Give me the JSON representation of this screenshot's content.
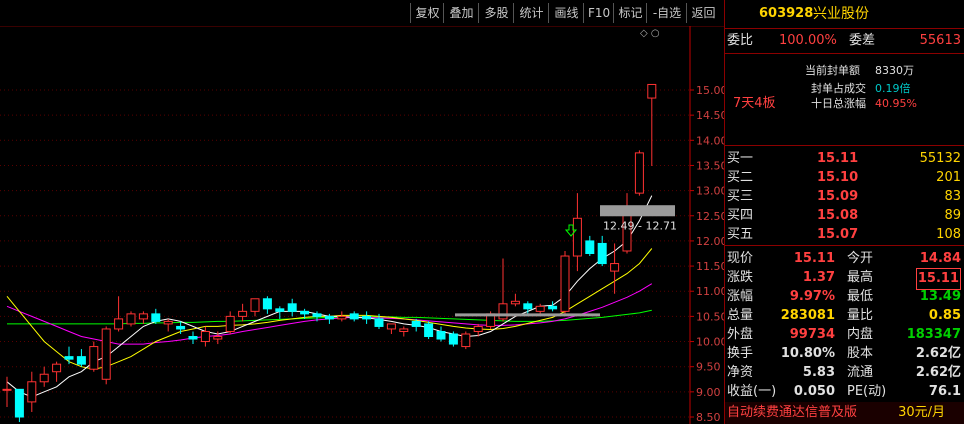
{
  "toolbar": {
    "buttons": [
      "复权",
      "叠加",
      "多股",
      "统计",
      "画线",
      "F10",
      "标记",
      "-自选",
      "返回"
    ]
  },
  "chart": {
    "corner_icons": "◇ ○",
    "price_axis": [
      "15.00",
      "14.50",
      "14.00",
      "13.50",
      "13.00",
      "12.50",
      "12.00",
      "11.50",
      "11.00",
      "10.50",
      "10.00",
      "9.50",
      "9.00",
      "8.50"
    ],
    "range_label": "12.49 - 12.71"
  },
  "quote": {
    "code": "603928",
    "name": "兴业股份",
    "weibi_label": "委比",
    "weibi_value": "100.00%",
    "weicha_label": "委差",
    "weicha_value": "55613",
    "seal_amount_label": "当前封单额",
    "seal_amount_value": "8330万",
    "seal_ratio_label": "封单占成交",
    "seal_ratio_value": "0.19倍",
    "ten_day_label": "十日总涨幅",
    "ten_day_value": "40.95%",
    "streak": "7天4板",
    "bids": [
      {
        "label": "买一",
        "price": "15.11",
        "vol": "55132"
      },
      {
        "label": "买二",
        "price": "15.10",
        "vol": "201"
      },
      {
        "label": "买三",
        "price": "15.09",
        "vol": "83"
      },
      {
        "label": "买四",
        "price": "15.08",
        "vol": "89"
      },
      {
        "label": "买五",
        "price": "15.07",
        "vol": "108"
      }
    ],
    "stats": [
      {
        "l1": "现价",
        "v1": "15.11",
        "l2": "今开",
        "v2": "14.84"
      },
      {
        "l1": "涨跌",
        "v1": "1.37",
        "l2": "最高",
        "v2": "15.11"
      },
      {
        "l1": "涨幅",
        "v1": "9.97%",
        "l2": "最低",
        "v2": "13.49"
      },
      {
        "l1": "总量",
        "v1": "283081",
        "l2": "量比",
        "v2": "0.85"
      },
      {
        "l1": "外盘",
        "v1": "99734",
        "l2": "内盘",
        "v2": "183347"
      },
      {
        "l1": "换手",
        "v1": "10.80%",
        "l2": "股本",
        "v2": "2.62亿"
      },
      {
        "l1": "净资",
        "v1": "5.83",
        "l2": "流通",
        "v2": "2.62亿"
      },
      {
        "l1": "收益(一)",
        "v1": "0.050",
        "l2": "PE(动)",
        "v2": "76.1"
      }
    ],
    "promo": "自动续费通达信普及版",
    "promo_price": "30元/月"
  },
  "colors": {
    "up": "#ff3232",
    "down": "#00ffff",
    "ma5": "#ffffff",
    "ma10": "#ffff00",
    "ma20": "#ff00ff",
    "ma60": "#00ff00",
    "axis": "#c00000"
  },
  "chart_data": {
    "type": "candlestick",
    "candles": [
      {
        "o": 9.05,
        "h": 9.3,
        "l": 8.7,
        "c": 9.05
      },
      {
        "o": 9.05,
        "h": 9.0,
        "l": 8.4,
        "c": 8.5
      },
      {
        "o": 8.8,
        "h": 9.4,
        "l": 8.6,
        "c": 9.2
      },
      {
        "o": 9.2,
        "h": 9.5,
        "l": 9.1,
        "c": 9.35
      },
      {
        "o": 9.4,
        "h": 9.6,
        "l": 9.2,
        "c": 9.55
      },
      {
        "o": 9.7,
        "h": 9.9,
        "l": 9.55,
        "c": 9.65
      },
      {
        "o": 9.7,
        "h": 9.85,
        "l": 9.5,
        "c": 9.55
      },
      {
        "o": 9.45,
        "h": 10.0,
        "l": 9.4,
        "c": 9.9
      },
      {
        "o": 9.25,
        "h": 10.3,
        "l": 9.15,
        "c": 10.25
      },
      {
        "o": 10.25,
        "h": 10.9,
        "l": 10.2,
        "c": 10.45
      },
      {
        "o": 10.35,
        "h": 10.6,
        "l": 10.3,
        "c": 10.55
      },
      {
        "o": 10.45,
        "h": 10.6,
        "l": 10.35,
        "c": 10.55
      },
      {
        "o": 10.55,
        "h": 10.65,
        "l": 10.35,
        "c": 10.4
      },
      {
        "o": 10.35,
        "h": 10.45,
        "l": 10.2,
        "c": 10.4
      },
      {
        "o": 10.3,
        "h": 10.4,
        "l": 10.15,
        "c": 10.25
      },
      {
        "o": 10.1,
        "h": 10.2,
        "l": 9.95,
        "c": 10.05
      },
      {
        "o": 10.0,
        "h": 10.3,
        "l": 9.9,
        "c": 10.2
      },
      {
        "o": 10.05,
        "h": 10.2,
        "l": 9.95,
        "c": 10.1
      },
      {
        "o": 10.2,
        "h": 10.6,
        "l": 10.15,
        "c": 10.5
      },
      {
        "o": 10.5,
        "h": 10.75,
        "l": 10.4,
        "c": 10.6
      },
      {
        "o": 10.6,
        "h": 10.85,
        "l": 10.5,
        "c": 10.85
      },
      {
        "o": 10.85,
        "h": 10.9,
        "l": 10.55,
        "c": 10.65
      },
      {
        "o": 10.65,
        "h": 10.7,
        "l": 10.45,
        "c": 10.6
      },
      {
        "o": 10.75,
        "h": 10.85,
        "l": 10.5,
        "c": 10.6
      },
      {
        "o": 10.6,
        "h": 10.65,
        "l": 10.45,
        "c": 10.55
      },
      {
        "o": 10.55,
        "h": 10.6,
        "l": 10.4,
        "c": 10.5
      },
      {
        "o": 10.5,
        "h": 10.55,
        "l": 10.35,
        "c": 10.45
      },
      {
        "o": 10.45,
        "h": 10.6,
        "l": 10.4,
        "c": 10.5
      },
      {
        "o": 10.55,
        "h": 10.6,
        "l": 10.4,
        "c": 10.45
      },
      {
        "o": 10.5,
        "h": 10.6,
        "l": 10.35,
        "c": 10.45
      },
      {
        "o": 10.45,
        "h": 10.55,
        "l": 10.25,
        "c": 10.3
      },
      {
        "o": 10.25,
        "h": 10.35,
        "l": 10.15,
        "c": 10.35
      },
      {
        "o": 10.2,
        "h": 10.3,
        "l": 10.1,
        "c": 10.25
      },
      {
        "o": 10.4,
        "h": 10.45,
        "l": 10.2,
        "c": 10.3
      },
      {
        "o": 10.35,
        "h": 10.4,
        "l": 10.05,
        "c": 10.1
      },
      {
        "o": 10.2,
        "h": 10.3,
        "l": 10.0,
        "c": 10.05
      },
      {
        "o": 10.15,
        "h": 10.2,
        "l": 9.9,
        "c": 9.95
      },
      {
        "o": 9.9,
        "h": 10.2,
        "l": 9.85,
        "c": 10.15
      },
      {
        "o": 10.2,
        "h": 10.35,
        "l": 10.1,
        "c": 10.3
      },
      {
        "o": 10.3,
        "h": 10.6,
        "l": 10.25,
        "c": 10.55
      },
      {
        "o": 10.45,
        "h": 11.65,
        "l": 10.4,
        "c": 10.75
      },
      {
        "o": 10.75,
        "h": 10.95,
        "l": 10.7,
        "c": 10.8
      },
      {
        "o": 10.75,
        "h": 10.8,
        "l": 10.55,
        "c": 10.65
      },
      {
        "o": 10.6,
        "h": 10.75,
        "l": 10.55,
        "c": 10.7
      },
      {
        "o": 10.7,
        "h": 10.8,
        "l": 10.6,
        "c": 10.65
      },
      {
        "o": 10.6,
        "h": 11.8,
        "l": 10.55,
        "c": 11.7
      },
      {
        "o": 11.7,
        "h": 12.95,
        "l": 11.4,
        "c": 12.45
      },
      {
        "o": 12.0,
        "h": 12.1,
        "l": 11.7,
        "c": 11.75
      },
      {
        "o": 11.95,
        "h": 12.1,
        "l": 11.5,
        "c": 11.55
      },
      {
        "o": 11.4,
        "h": 11.95,
        "l": 10.95,
        "c": 11.55
      },
      {
        "o": 11.8,
        "h": 12.95,
        "l": 11.75,
        "c": 12.55
      },
      {
        "o": 12.95,
        "h": 13.8,
        "l": 12.9,
        "c": 13.75
      },
      {
        "o": 14.84,
        "h": 15.11,
        "l": 13.49,
        "c": 15.11
      }
    ],
    "ma5": [
      9.2,
      9.0,
      8.9,
      9.0,
      9.1,
      9.3,
      9.4,
      9.6,
      9.7,
      9.9,
      10.1,
      10.3,
      10.4,
      10.45,
      10.4,
      10.3,
      10.2,
      10.15,
      10.2,
      10.3,
      10.4,
      10.5,
      10.6,
      10.6,
      10.6,
      10.55,
      10.5,
      10.5,
      10.48,
      10.47,
      10.44,
      10.4,
      10.35,
      10.32,
      10.28,
      10.2,
      10.15,
      10.1,
      10.12,
      10.2,
      10.35,
      10.5,
      10.6,
      10.7,
      10.72,
      10.9,
      11.2,
      11.45,
      11.65,
      11.8,
      12.0,
      12.4,
      12.9
    ],
    "ma10": [
      10.9,
      10.6,
      10.3,
      10.0,
      9.8,
      9.6,
      9.5,
      9.45,
      9.5,
      9.6,
      9.7,
      9.85,
      10.0,
      10.1,
      10.2,
      10.25,
      10.3,
      10.3,
      10.32,
      10.33,
      10.35,
      10.38,
      10.42,
      10.45,
      10.48,
      10.5,
      10.5,
      10.52,
      10.52,
      10.52,
      10.5,
      10.48,
      10.45,
      10.42,
      10.38,
      10.34,
      10.3,
      10.27,
      10.25,
      10.24,
      10.26,
      10.3,
      10.36,
      10.42,
      10.48,
      10.6,
      10.75,
      10.9,
      11.05,
      11.2,
      11.35,
      11.55,
      11.85
    ],
    "ma20": [
      10.7,
      10.6,
      10.5,
      10.4,
      10.3,
      10.2,
      10.1,
      10.05,
      10.0,
      9.95,
      9.95,
      9.95,
      9.98,
      10.0,
      10.03,
      10.07,
      10.1,
      10.12,
      10.15,
      10.2,
      10.24,
      10.28,
      10.32,
      10.36,
      10.4,
      10.43,
      10.45,
      10.47,
      10.48,
      10.48,
      10.47,
      10.46,
      10.45,
      10.43,
      10.41,
      10.39,
      10.37,
      10.35,
      10.33,
      10.32,
      10.32,
      10.33,
      10.35,
      10.37,
      10.4,
      10.45,
      10.52,
      10.6,
      10.68,
      10.78,
      10.88,
      11.0,
      11.15
    ],
    "ma60": [
      10.35,
      10.35,
      10.35,
      10.35,
      10.35,
      10.35,
      10.35,
      10.35,
      10.35,
      10.35,
      10.36,
      10.36,
      10.37,
      10.37,
      10.38,
      10.38,
      10.39,
      10.4,
      10.4,
      10.41,
      10.42,
      10.43,
      10.44,
      10.45,
      10.46,
      10.47,
      10.48,
      10.48,
      10.49,
      10.49,
      10.49,
      10.49,
      10.48,
      10.48,
      10.47,
      10.46,
      10.45,
      10.44,
      10.43,
      10.42,
      10.41,
      10.4,
      10.4,
      10.4,
      10.41,
      10.42,
      10.44,
      10.46,
      10.48,
      10.51,
      10.54,
      10.57,
      10.62
    ],
    "ylim": [
      8.4,
      15.4
    ]
  }
}
